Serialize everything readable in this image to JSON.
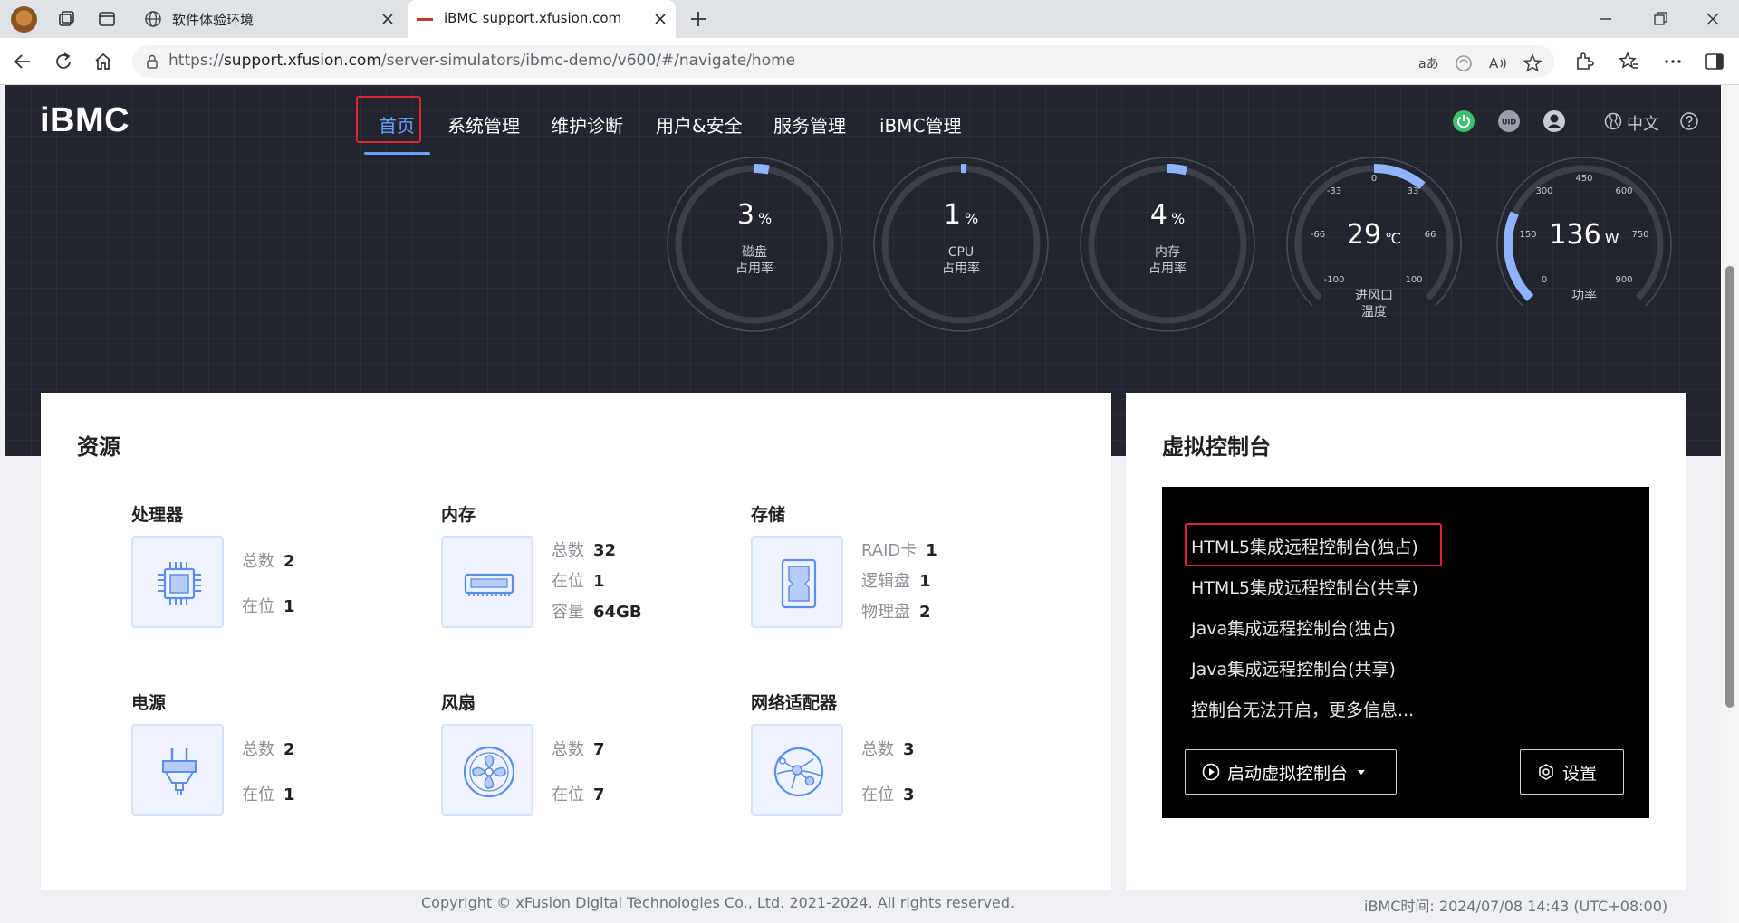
{
  "browser": {
    "tabs": [
      {
        "title": "软件体验环境"
      },
      {
        "title": "iBMC support.xfusion.com"
      }
    ],
    "url_prefix": "https://",
    "url_host": "support.xfusion.com",
    "url_path": "/server-simulators/ibmc-demo/v600/#/navigate/home"
  },
  "header": {
    "logo": "iBMC",
    "menu": [
      {
        "label": "首页"
      },
      {
        "label": "系统管理"
      },
      {
        "label": "维护诊断"
      },
      {
        "label": "用户&安全"
      },
      {
        "label": "服务管理"
      },
      {
        "label": "iBMC管理"
      }
    ],
    "active_menu": "首页",
    "language": "中文",
    "icons": [
      "power-icon",
      "uid-icon",
      "user-icon",
      "globe-icon",
      "help-icon"
    ],
    "power_color": "#3fbf6d"
  },
  "gauges": {
    "disk": {
      "value": "3",
      "unit": "%",
      "label_1": "磁盘",
      "label_2": "占用率",
      "fraction": 0.03
    },
    "cpu": {
      "value": "1",
      "unit": "%",
      "label_1": "CPU",
      "label_2": "占用率",
      "fraction": 0.01
    },
    "memory": {
      "value": "4",
      "unit": "%",
      "label_1": "内存",
      "label_2": "占用率",
      "fraction": 0.04
    },
    "inlet_temp": {
      "value": "29",
      "unit": "℃",
      "label_1": "进风口",
      "label_2": "温度",
      "ticks": [
        "-100",
        "-66",
        "-33",
        "0",
        "33",
        "66",
        "100"
      ],
      "min": -100,
      "max": 100
    },
    "power": {
      "value": "136",
      "unit": "W",
      "label_1": "功率",
      "ticks": [
        "0",
        "150",
        "300",
        "450",
        "600",
        "750",
        "900"
      ],
      "min": 0,
      "max": 900
    }
  },
  "resources": {
    "title": "资源",
    "processor": {
      "title": "处理器",
      "total_label": "总数",
      "total": "2",
      "present_label": "在位",
      "present": "1"
    },
    "memory": {
      "title": "内存",
      "total_label": "总数",
      "total": "32",
      "present_label": "在位",
      "present": "1",
      "capacity_label": "容量",
      "capacity": "64GB"
    },
    "storage": {
      "title": "存储",
      "raid_label": "RAID卡",
      "raid": "1",
      "logical_label": "逻辑盘",
      "logical": "1",
      "physical_label": "物理盘",
      "physical": "2"
    },
    "power": {
      "title": "电源",
      "total_label": "总数",
      "total": "2",
      "present_label": "在位",
      "present": "1"
    },
    "fan": {
      "title": "风扇",
      "total_label": "总数",
      "total": "7",
      "present_label": "在位",
      "present": "7"
    },
    "network": {
      "title": "网络适配器",
      "total_label": "总数",
      "total": "3",
      "present_label": "在位",
      "present": "3"
    }
  },
  "virtual_console": {
    "title": "虚拟控制台",
    "items": [
      "HTML5集成远程控制台(独占)",
      "HTML5集成远程控制台(共享)",
      "Java集成远程控制台(独占)",
      "Java集成远程控制台(共享)",
      "控制台无法开启，更多信息..."
    ],
    "launch_button": "启动虚拟控制台",
    "settings_button": "设置"
  },
  "footer": {
    "copyright": "Copyright © xFusion Digital Technologies Co., Ltd. 2021-2024. All rights reserved.",
    "time_label": "iBMC时间:",
    "time_value": "2024/07/08 14:43 (UTC+08:00)"
  },
  "colors": {
    "accent": "#6aa0ff",
    "highlight": "#e02434",
    "hero_bg": "#22252e"
  }
}
